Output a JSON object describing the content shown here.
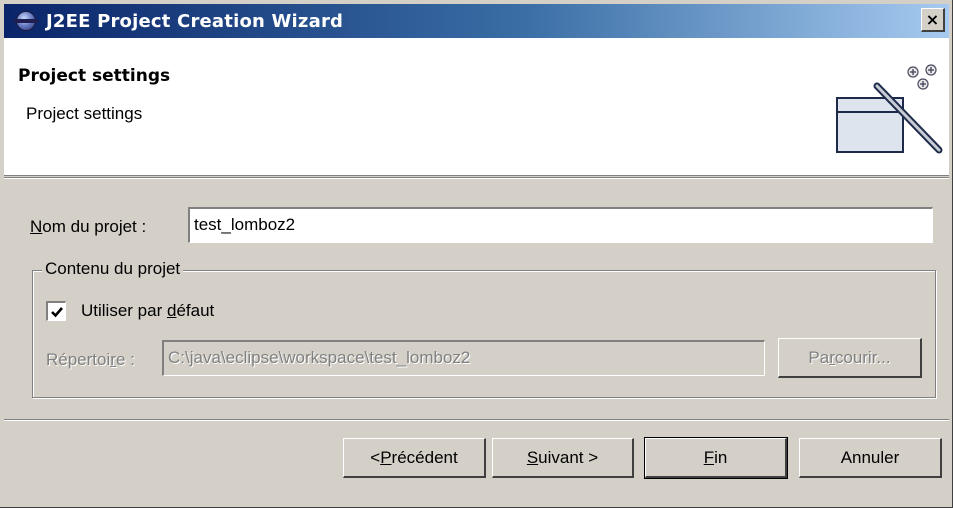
{
  "window": {
    "title": "J2EE Project Creation Wizard",
    "close_label": "×"
  },
  "header": {
    "title": "Project settings",
    "description": "Project settings"
  },
  "form": {
    "project_name_label_mnemonic": "N",
    "project_name_label_rest": "om du projet :",
    "project_name_value": "test_lomboz2",
    "group_label": "Contenu du projet",
    "use_default_checked": true,
    "use_default_label_pre": "Utiliser par ",
    "use_default_label_mnemonic": "d",
    "use_default_label_post": "éfaut",
    "directory_label_pre": "Répertoi",
    "directory_label_mnemonic": "r",
    "directory_label_post": "e :",
    "directory_value": "C:\\java\\eclipse\\workspace\\test_lomboz2",
    "browse_label_pre": "Pa",
    "browse_label_mnemonic": "r",
    "browse_label_post": "courir..."
  },
  "buttons": {
    "back_pre": "< ",
    "back_mnemonic": "P",
    "back_post": "récédent",
    "next_mnemonic": "S",
    "next_post": "uivant >",
    "finish_mnemonic": "F",
    "finish_post": "in",
    "cancel": "Annuler"
  },
  "icons": {
    "app": "eclipse-globe-icon",
    "wizard": "new-project-wizard-icon",
    "check": "checkmark-icon"
  }
}
